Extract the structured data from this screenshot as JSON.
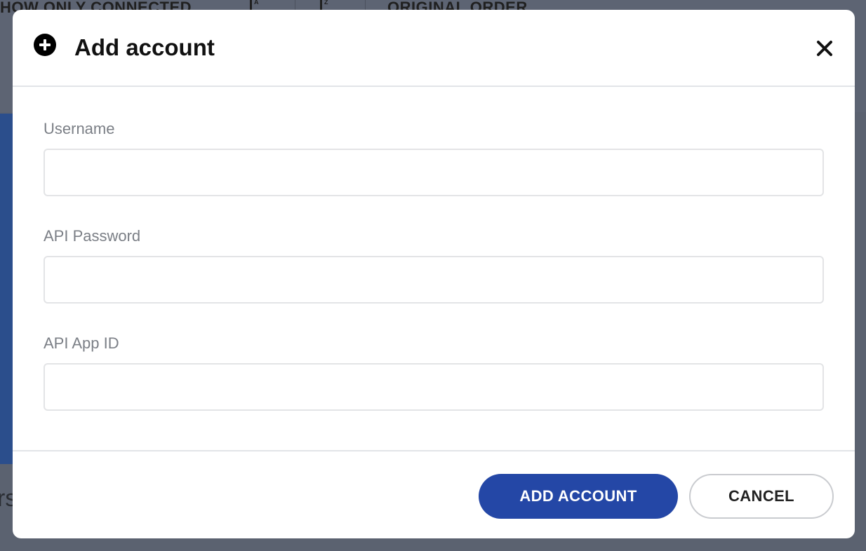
{
  "background": {
    "toolbar": {
      "show_connected_label": "HOW ONLY CONNECTED",
      "original_order_label": "ORIGINAL ORDER",
      "sort_az_icon": "sort-az-icon",
      "sort_za_icon": "sort-za-icon"
    },
    "partial_text": "rs"
  },
  "modal": {
    "title": "Add account",
    "header_icon": "add-circle-icon",
    "close_icon": "close-icon",
    "fields": [
      {
        "label": "Username",
        "value": "",
        "placeholder": ""
      },
      {
        "label": "API Password",
        "value": "",
        "placeholder": ""
      },
      {
        "label": "API App ID",
        "value": "",
        "placeholder": ""
      }
    ],
    "footer": {
      "primary_label": "ADD ACCOUNT",
      "secondary_label": "CANCEL"
    }
  },
  "colors": {
    "overlay": "#5b6270",
    "primary_button": "#2447a6",
    "label_text": "#7b7f86",
    "background_panel": "#2b4e8c"
  }
}
